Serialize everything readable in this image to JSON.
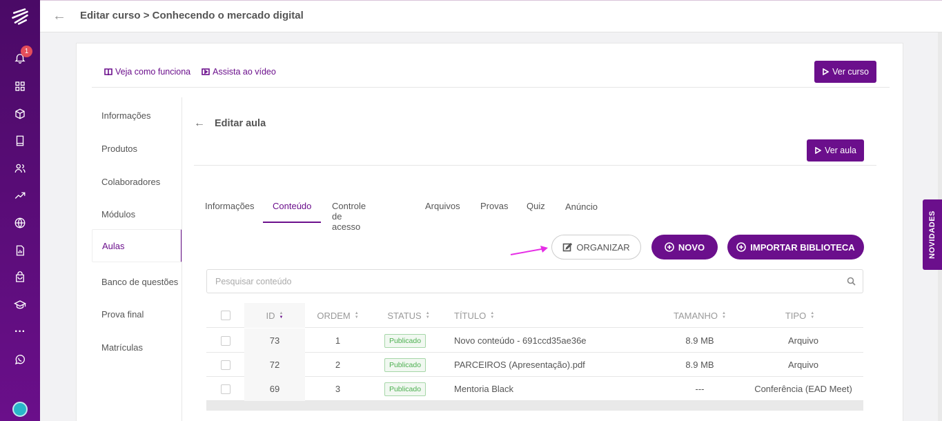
{
  "rail": {
    "notif_count": "1",
    "icons": [
      "logo-icon",
      "bell-icon",
      "grid-icon",
      "cube-icon",
      "book-icon",
      "users-icon",
      "trend-icon",
      "globe-icon",
      "report-icon",
      "bag-icon",
      "graduation-icon",
      "more-icon",
      "whatsapp-icon"
    ]
  },
  "topbar": {
    "title": "Editar curso > Conhecendo o mercado digital"
  },
  "help": {
    "how_it_works": "Veja como funciona",
    "watch_video": "Assista ao vídeo"
  },
  "buttons": {
    "ver_curso": "Ver curso",
    "ver_aula": "Ver aula",
    "organizar": "ORGANIZAR",
    "novo": "NOVO",
    "importar": "IMPORTAR BIBLIOTECA"
  },
  "sidemenu": [
    "Informações",
    "Produtos",
    "Colaboradores",
    "Módulos",
    "Aulas",
    "Banco de questões",
    "Prova final",
    "Matrículas"
  ],
  "lesson": {
    "title": "Editar aula"
  },
  "tabs": [
    "Informações",
    "Conteúdo",
    "Controle de acesso",
    "Arquivos",
    "Provas",
    "Quiz",
    "Anúncio"
  ],
  "search": {
    "placeholder": "Pesquisar conteúdo"
  },
  "table": {
    "columns": [
      "ID",
      "ORDEM",
      "STATUS",
      "TÍTULO",
      "TAMANHO",
      "TIPO"
    ],
    "rows": [
      {
        "id": "73",
        "ordem": "1",
        "status": "Publicado",
        "titulo": "Novo conteúdo - 691ccd35ae36e",
        "tamanho": "8.9 MB",
        "tipo": "Arquivo"
      },
      {
        "id": "72",
        "ordem": "2",
        "status": "Publicado",
        "titulo": "PARCEIROS (Apresentação).pdf",
        "tamanho": "8.9 MB",
        "tipo": "Arquivo"
      },
      {
        "id": "69",
        "ordem": "3",
        "status": "Publicado",
        "titulo": "Mentoria Black",
        "tamanho": "---",
        "tipo": "Conferência (EAD Meet)"
      }
    ]
  },
  "novidades": "NOVIDADES",
  "colors": {
    "brand": "#6b0f8c",
    "rail_top": "#4a0a66",
    "badge_green": "#4caf50",
    "annotation_arrow": "#e62ee6"
  }
}
